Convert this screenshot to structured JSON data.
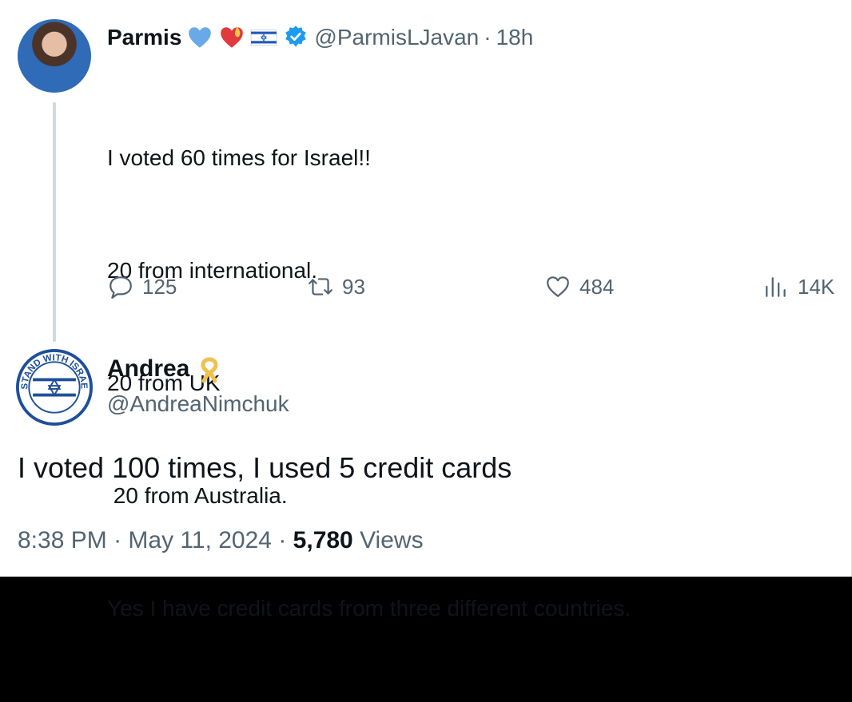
{
  "tweet1": {
    "display_name": "Parmis",
    "handle": "@ParmisLJavan",
    "separator": "·",
    "time": "18h",
    "text_lines": [
      "I voted 60 times for Israel!!",
      "20 from international.",
      "20 from UK",
      " 20 from Australia.",
      "Yes I have credit cards from three different countries."
    ],
    "metrics": {
      "replies": "125",
      "reposts": "93",
      "likes": "484",
      "views": "14K"
    }
  },
  "tweet2": {
    "display_name": "Andrea",
    "handle": "@AndreaNimchuk",
    "avatar_badge_text": "I STAND WITH ISRAEL",
    "text": "I voted 100 times, I used 5 credit cards",
    "time": "8:38 PM",
    "date": "May 11, 2024",
    "views_count": "5,780",
    "views_label": "Views",
    "separator": "·"
  },
  "colors": {
    "primary_text": "#0f1419",
    "secondary_text": "#536471",
    "verified_blue": "#1d9bf0",
    "thread_line": "#cfd9de"
  }
}
